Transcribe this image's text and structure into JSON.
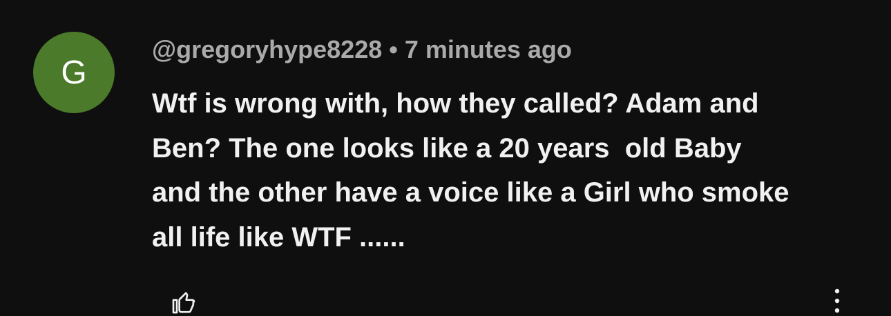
{
  "comment": {
    "avatar_letter": "G",
    "author": "@gregoryhype8228",
    "separator": "•",
    "timestamp": "7 minutes ago",
    "text_lines": [
      "Wtf is wrong with, how they called? Adam and",
      "Ben? The one looks like a 20 years  old Baby",
      "and the other have a voice like a Girl who smoke",
      "all life like WTF ......"
    ]
  },
  "colors": {
    "background": "#0f0f0f",
    "avatar": "#4a7a2a",
    "meta_text": "#aaaaaa",
    "body_text": "#f1f1f1"
  },
  "icons": {
    "like": "thumbs-up-icon",
    "more": "more-vertical-icon"
  }
}
